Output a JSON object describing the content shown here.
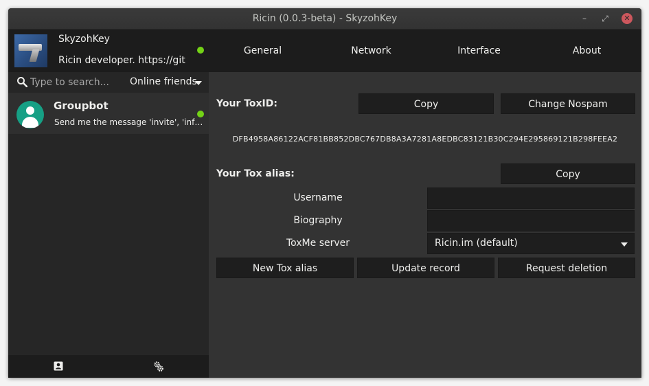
{
  "window": {
    "title": "Ricin (0.0.3-beta) - SkyzohKey",
    "minimize_glyph": "–",
    "maximize_glyph": "⤢",
    "close_glyph": "✕"
  },
  "profile": {
    "name": "SkyzohKey",
    "status_message": "Ricin developer. https://github.com/SkyzohKey",
    "presence_color": "#73d216"
  },
  "search": {
    "placeholder": "Type to search...",
    "value": "",
    "filter_label": "Online friends"
  },
  "friends": [
    {
      "name": "Groupbot",
      "last_message": "Send me the message 'invite', 'info', 'help', a group number or a group password",
      "presence_color": "#73d216",
      "avatar_color": "#16a085"
    }
  ],
  "sidebar_footer": {
    "contacts_icon": "contact-card-icon",
    "settings_icon": "gears-icon"
  },
  "tabs": [
    "General",
    "Network",
    "Interface",
    "About"
  ],
  "general": {
    "toxid_label": "Your ToxID:",
    "copy_label": "Copy",
    "change_nospam_label": "Change Nospam",
    "toxid": "DFB4958A86122ACF81BB852DBC767DB8A3A7281A8EDBC83121B30C294E295869121B298FEEA2",
    "alias_label": "Your Tox alias:",
    "alias_copy_label": "Copy",
    "username_label": "Username",
    "username_value": "",
    "biography_label": "Biography",
    "biography_value": "",
    "toxme_label": "ToxMe server",
    "toxme_value": "Ricin.im (default)",
    "new_alias_label": "New Tox alias",
    "update_record_label": "Update record",
    "request_deletion_label": "Request deletion"
  }
}
